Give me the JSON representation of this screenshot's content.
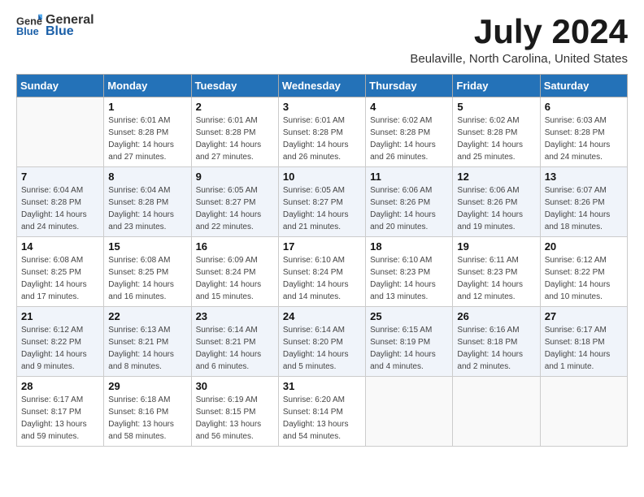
{
  "logo": {
    "text_general": "General",
    "text_blue": "Blue"
  },
  "title": "July 2024",
  "subtitle": "Beulaville, North Carolina, United States",
  "days_of_week": [
    "Sunday",
    "Monday",
    "Tuesday",
    "Wednesday",
    "Thursday",
    "Friday",
    "Saturday"
  ],
  "weeks": [
    [
      {
        "day": "",
        "info": ""
      },
      {
        "day": "1",
        "info": "Sunrise: 6:01 AM\nSunset: 8:28 PM\nDaylight: 14 hours\nand 27 minutes."
      },
      {
        "day": "2",
        "info": "Sunrise: 6:01 AM\nSunset: 8:28 PM\nDaylight: 14 hours\nand 27 minutes."
      },
      {
        "day": "3",
        "info": "Sunrise: 6:01 AM\nSunset: 8:28 PM\nDaylight: 14 hours\nand 26 minutes."
      },
      {
        "day": "4",
        "info": "Sunrise: 6:02 AM\nSunset: 8:28 PM\nDaylight: 14 hours\nand 26 minutes."
      },
      {
        "day": "5",
        "info": "Sunrise: 6:02 AM\nSunset: 8:28 PM\nDaylight: 14 hours\nand 25 minutes."
      },
      {
        "day": "6",
        "info": "Sunrise: 6:03 AM\nSunset: 8:28 PM\nDaylight: 14 hours\nand 24 minutes."
      }
    ],
    [
      {
        "day": "7",
        "info": "Sunrise: 6:04 AM\nSunset: 8:28 PM\nDaylight: 14 hours\nand 24 minutes."
      },
      {
        "day": "8",
        "info": "Sunrise: 6:04 AM\nSunset: 8:28 PM\nDaylight: 14 hours\nand 23 minutes."
      },
      {
        "day": "9",
        "info": "Sunrise: 6:05 AM\nSunset: 8:27 PM\nDaylight: 14 hours\nand 22 minutes."
      },
      {
        "day": "10",
        "info": "Sunrise: 6:05 AM\nSunset: 8:27 PM\nDaylight: 14 hours\nand 21 minutes."
      },
      {
        "day": "11",
        "info": "Sunrise: 6:06 AM\nSunset: 8:26 PM\nDaylight: 14 hours\nand 20 minutes."
      },
      {
        "day": "12",
        "info": "Sunrise: 6:06 AM\nSunset: 8:26 PM\nDaylight: 14 hours\nand 19 minutes."
      },
      {
        "day": "13",
        "info": "Sunrise: 6:07 AM\nSunset: 8:26 PM\nDaylight: 14 hours\nand 18 minutes."
      }
    ],
    [
      {
        "day": "14",
        "info": "Sunrise: 6:08 AM\nSunset: 8:25 PM\nDaylight: 14 hours\nand 17 minutes."
      },
      {
        "day": "15",
        "info": "Sunrise: 6:08 AM\nSunset: 8:25 PM\nDaylight: 14 hours\nand 16 minutes."
      },
      {
        "day": "16",
        "info": "Sunrise: 6:09 AM\nSunset: 8:24 PM\nDaylight: 14 hours\nand 15 minutes."
      },
      {
        "day": "17",
        "info": "Sunrise: 6:10 AM\nSunset: 8:24 PM\nDaylight: 14 hours\nand 14 minutes."
      },
      {
        "day": "18",
        "info": "Sunrise: 6:10 AM\nSunset: 8:23 PM\nDaylight: 14 hours\nand 13 minutes."
      },
      {
        "day": "19",
        "info": "Sunrise: 6:11 AM\nSunset: 8:23 PM\nDaylight: 14 hours\nand 12 minutes."
      },
      {
        "day": "20",
        "info": "Sunrise: 6:12 AM\nSunset: 8:22 PM\nDaylight: 14 hours\nand 10 minutes."
      }
    ],
    [
      {
        "day": "21",
        "info": "Sunrise: 6:12 AM\nSunset: 8:22 PM\nDaylight: 14 hours\nand 9 minutes."
      },
      {
        "day": "22",
        "info": "Sunrise: 6:13 AM\nSunset: 8:21 PM\nDaylight: 14 hours\nand 8 minutes."
      },
      {
        "day": "23",
        "info": "Sunrise: 6:14 AM\nSunset: 8:21 PM\nDaylight: 14 hours\nand 6 minutes."
      },
      {
        "day": "24",
        "info": "Sunrise: 6:14 AM\nSunset: 8:20 PM\nDaylight: 14 hours\nand 5 minutes."
      },
      {
        "day": "25",
        "info": "Sunrise: 6:15 AM\nSunset: 8:19 PM\nDaylight: 14 hours\nand 4 minutes."
      },
      {
        "day": "26",
        "info": "Sunrise: 6:16 AM\nSunset: 8:18 PM\nDaylight: 14 hours\nand 2 minutes."
      },
      {
        "day": "27",
        "info": "Sunrise: 6:17 AM\nSunset: 8:18 PM\nDaylight: 14 hours\nand 1 minute."
      }
    ],
    [
      {
        "day": "28",
        "info": "Sunrise: 6:17 AM\nSunset: 8:17 PM\nDaylight: 13 hours\nand 59 minutes."
      },
      {
        "day": "29",
        "info": "Sunrise: 6:18 AM\nSunset: 8:16 PM\nDaylight: 13 hours\nand 58 minutes."
      },
      {
        "day": "30",
        "info": "Sunrise: 6:19 AM\nSunset: 8:15 PM\nDaylight: 13 hours\nand 56 minutes."
      },
      {
        "day": "31",
        "info": "Sunrise: 6:20 AM\nSunset: 8:14 PM\nDaylight: 13 hours\nand 54 minutes."
      },
      {
        "day": "",
        "info": ""
      },
      {
        "day": "",
        "info": ""
      },
      {
        "day": "",
        "info": ""
      }
    ]
  ],
  "accent_color": "#2472b8"
}
